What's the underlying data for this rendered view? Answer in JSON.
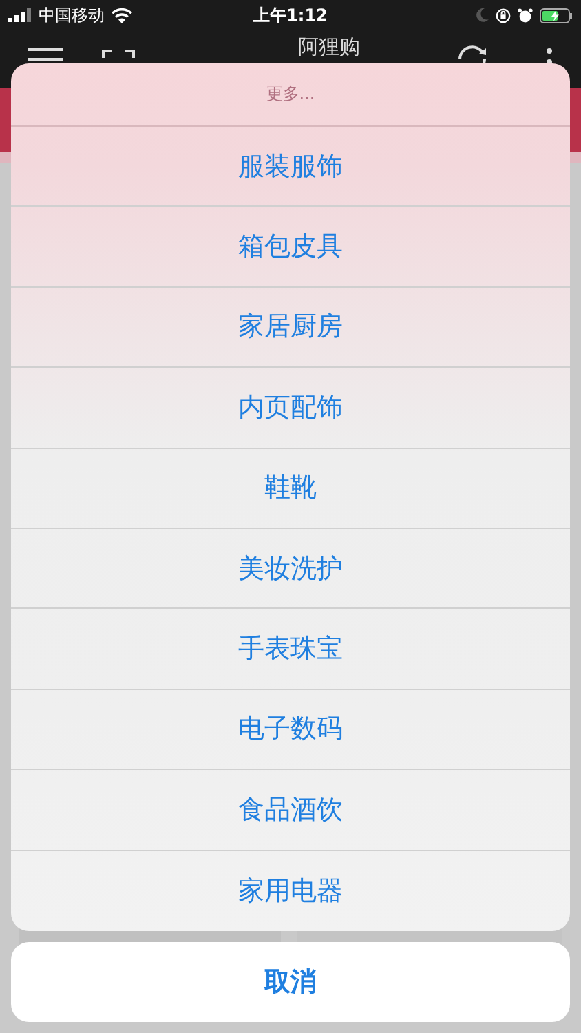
{
  "status_bar": {
    "carrier": "中国移动",
    "time": "上午1:12"
  },
  "nav_bar": {
    "title": "阿狸购"
  },
  "action_sheet": {
    "title": "更多...",
    "options": [
      "服装服饰",
      "箱包皮具",
      "家居厨房",
      "内页配饰",
      "鞋靴",
      "美妆洗护",
      "手表珠宝",
      "电子数码",
      "食品酒饮",
      "家用电器"
    ],
    "cancel": "取消"
  }
}
